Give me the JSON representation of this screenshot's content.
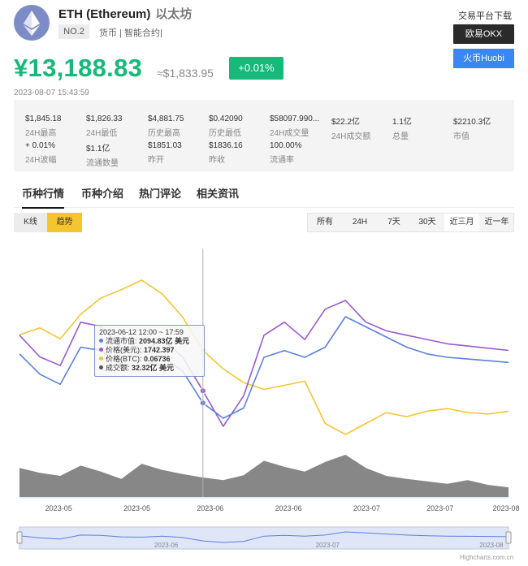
{
  "coin": {
    "name": "ETH (Ethereum)",
    "cn_name": "以太坊",
    "rank": "NO.2",
    "tags": "货币 | 智能合约|",
    "logo_icon": "ethereum-diamond-icon"
  },
  "download": {
    "title": "交易平台下载",
    "buttons": [
      "欧易OKX",
      "火币Huobi"
    ]
  },
  "price": {
    "cny": "¥13,188.83",
    "usd": "≈$1,833.95",
    "change": "+0.01%",
    "timestamp": "2023-08-07 15:43:59"
  },
  "stats": [
    {
      "value": "$1,845.18",
      "label": "24H最高"
    },
    {
      "value": "$1,826.33",
      "label": "24H最低"
    },
    {
      "value": "$4,881.75",
      "label": "历史最高"
    },
    {
      "value": "$0.42090",
      "label": "历史最低"
    },
    {
      "value": "$58097.990...",
      "label": "24H成交量"
    },
    {
      "value": "$22.2亿",
      "label": "24H成交额"
    },
    {
      "value": "1.1亿",
      "label": "总量"
    },
    {
      "value": "$2210.3亿",
      "label": "市值"
    },
    {
      "value": "+ 0.01%",
      "label": "24H波幅"
    },
    {
      "value": "$1.1亿",
      "label": "流通数量"
    },
    {
      "value": "$1851.03",
      "label": "昨开"
    },
    {
      "value": "$1836.16",
      "label": "昨收"
    },
    {
      "value": "100.00%",
      "label": "流通率"
    }
  ],
  "tabs": [
    "币种行情",
    "币种介绍",
    "热门评论",
    "相关资讯"
  ],
  "chart_type_toggle": [
    "K线",
    "趋势"
  ],
  "ranges": [
    "所有",
    "24H",
    "7天",
    "30天",
    "近三月",
    "近一年"
  ],
  "colors": {
    "up_green": "#16b979",
    "market_cap_series": "#5b7fe0",
    "price_usd_series": "#9b59d0",
    "price_btc_series": "#f5c530",
    "volume_series": "#7a7a7a",
    "okx_button": "#2a2a2a",
    "huobi_button": "#3a87f3"
  },
  "tooltip": {
    "date": "2023-06-12 12:00 ~ 17:59",
    "rows": [
      {
        "label": "流通市值:",
        "value": "2094.83亿 美元"
      },
      {
        "label": "价格(美元):",
        "value": "1742.397"
      },
      {
        "label": "价格(BTC):",
        "value": "0.06736"
      },
      {
        "label": "成交额:",
        "value": "32.32亿 美元"
      }
    ]
  },
  "credits": "Highcharts.com.cn",
  "chart_data": {
    "type": "line",
    "x_tick_labels": [
      "2023-05",
      "2023-05",
      "2023-06",
      "2023-06",
      "2023-07",
      "2023-07",
      "2023-08"
    ],
    "navigator_labels": [
      "2023-06",
      "2023-07",
      "2023-08"
    ],
    "grid": false,
    "series": [
      {
        "name": "流通市值",
        "values": [
          2240,
          2180,
          2150,
          2260,
          2250,
          2210,
          2200,
          2230,
          2190,
          2095,
          2050,
          2080,
          2230,
          2250,
          2230,
          2260,
          2350,
          2320,
          2290,
          2260,
          2240,
          2230,
          2225,
          2220,
          2215
        ]
      },
      {
        "name": "价格(美元)",
        "values": [
          1870,
          1820,
          1800,
          1900,
          1890,
          1840,
          1830,
          1860,
          1820,
          1742,
          1660,
          1730,
          1870,
          1900,
          1860,
          1930,
          1950,
          1900,
          1880,
          1870,
          1860,
          1850,
          1845,
          1840,
          1835
        ]
      },
      {
        "name": "价格(BTC)",
        "values": [
          0.0685,
          0.069,
          0.0682,
          0.07,
          0.0712,
          0.0718,
          0.0725,
          0.0715,
          0.0698,
          0.06736,
          0.066,
          0.065,
          0.0645,
          0.0648,
          0.0651,
          0.062,
          0.0612,
          0.062,
          0.0628,
          0.0625,
          0.0629,
          0.0631,
          0.0628,
          0.0627,
          0.0629
        ]
      },
      {
        "name": "成交额",
        "values": [
          48,
          40,
          35,
          52,
          42,
          30,
          55,
          45,
          38,
          32.32,
          28,
          36,
          60,
          50,
          42,
          58,
          70,
          48,
          35,
          30,
          26,
          22,
          28,
          20,
          16
        ]
      }
    ]
  }
}
